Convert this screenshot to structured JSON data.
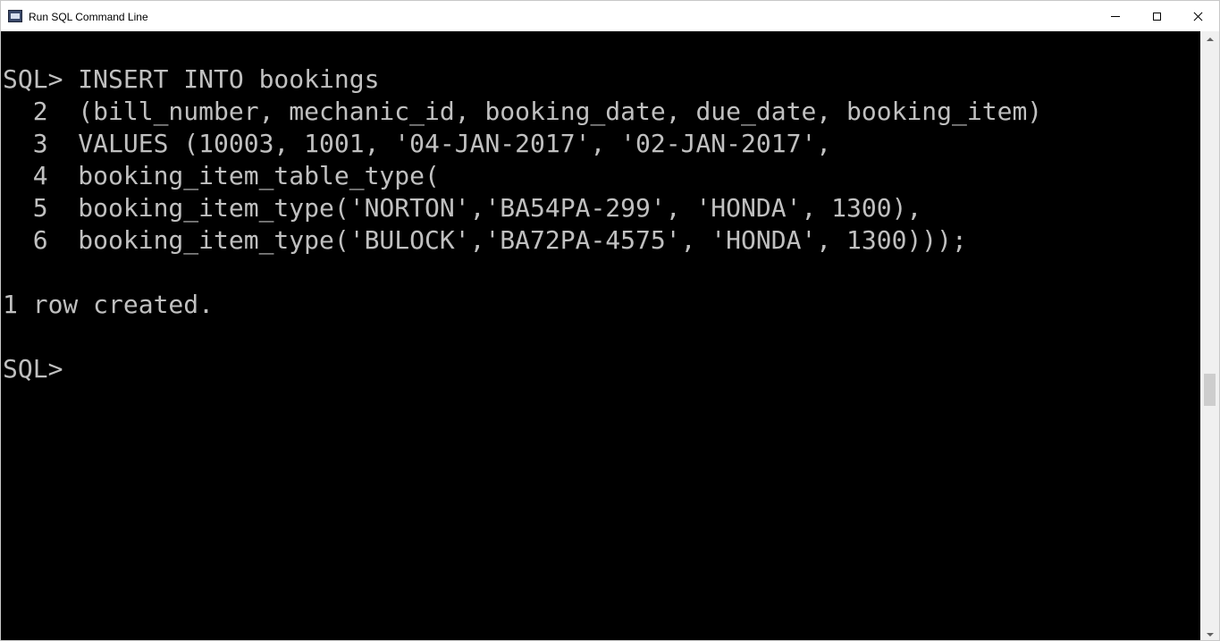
{
  "window": {
    "title": "Run SQL Command Line",
    "app_icon": "sql-command-line-icon",
    "controls": {
      "minimize_icon": "minimize-icon",
      "maximize_icon": "maximize-icon",
      "close_icon": "close-icon"
    }
  },
  "console": {
    "background": "#000000",
    "foreground": "#c0c0c0",
    "lines": [
      "SQL> INSERT INTO bookings",
      "  2  (bill_number, mechanic_id, booking_date, due_date, booking_item)",
      "  3  VALUES (10003, 1001, '04-JAN-2017', '02-JAN-2017',",
      "  4  booking_item_table_type(",
      "  5  booking_item_type('NORTON','BA54PA-299', 'HONDA', 1300),",
      "  6  booking_item_type('BULOCK','BA72PA-4575', 'HONDA', 1300)));",
      "1 row created.",
      "SQL>"
    ]
  },
  "scrollbar": {
    "up_icon": "scroll-up-arrow-icon",
    "down_icon": "scroll-down-arrow-icon"
  }
}
